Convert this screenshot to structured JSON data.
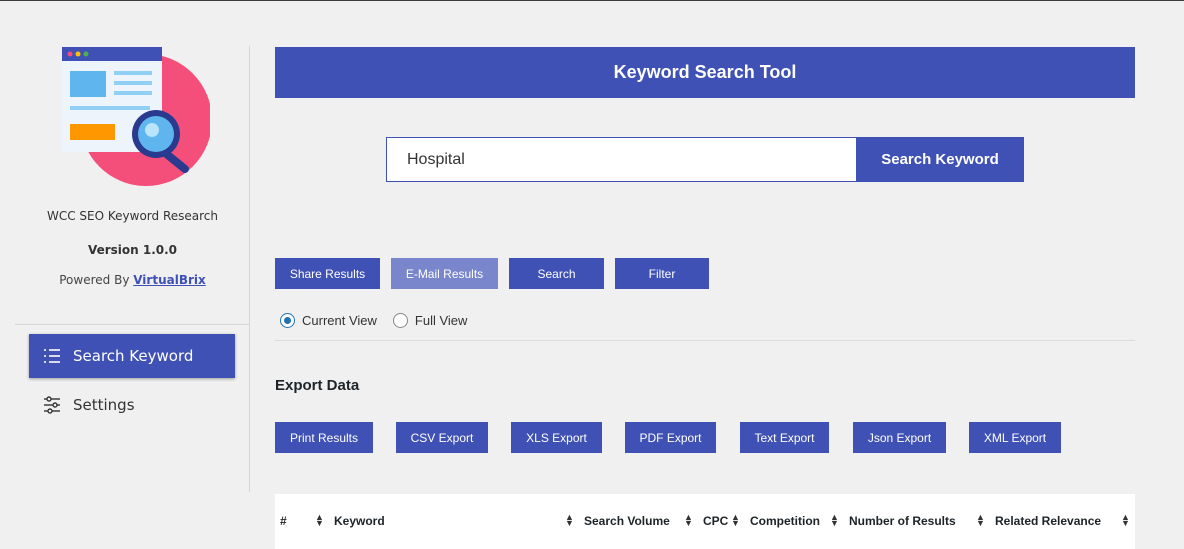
{
  "sidebar": {
    "app_name": "WCC SEO Keyword Research",
    "version": "Version 1.0.0",
    "powered_prefix": "Powered By ",
    "powered_link": "VirtualBrix",
    "nav": [
      {
        "label": "Search Keyword",
        "icon": "list-icon",
        "active": true
      },
      {
        "label": "Settings",
        "icon": "sliders-icon",
        "active": false
      }
    ]
  },
  "header": {
    "title": "Keyword Search Tool"
  },
  "search": {
    "value": "Hospital",
    "button": "Search Keyword"
  },
  "actions": [
    "Share Results",
    "E-Mail Results",
    "Search",
    "Filter"
  ],
  "view": {
    "current": "Current View",
    "full": "Full View",
    "selected": "current"
  },
  "export": {
    "title": "Export Data",
    "buttons": [
      "Print Results",
      "CSV Export",
      "XLS Export",
      "PDF Export",
      "Text Export",
      "Json Export",
      "XML Export"
    ]
  },
  "table": {
    "columns": [
      "#",
      "Keyword",
      "Search Volume",
      "CPC",
      "Competition",
      "Number of Results",
      "Related Relevance"
    ]
  },
  "colors": {
    "accent": "#3f51b5",
    "accent_disabled": "#7986cb",
    "logo_circle": "#f44f7a"
  }
}
